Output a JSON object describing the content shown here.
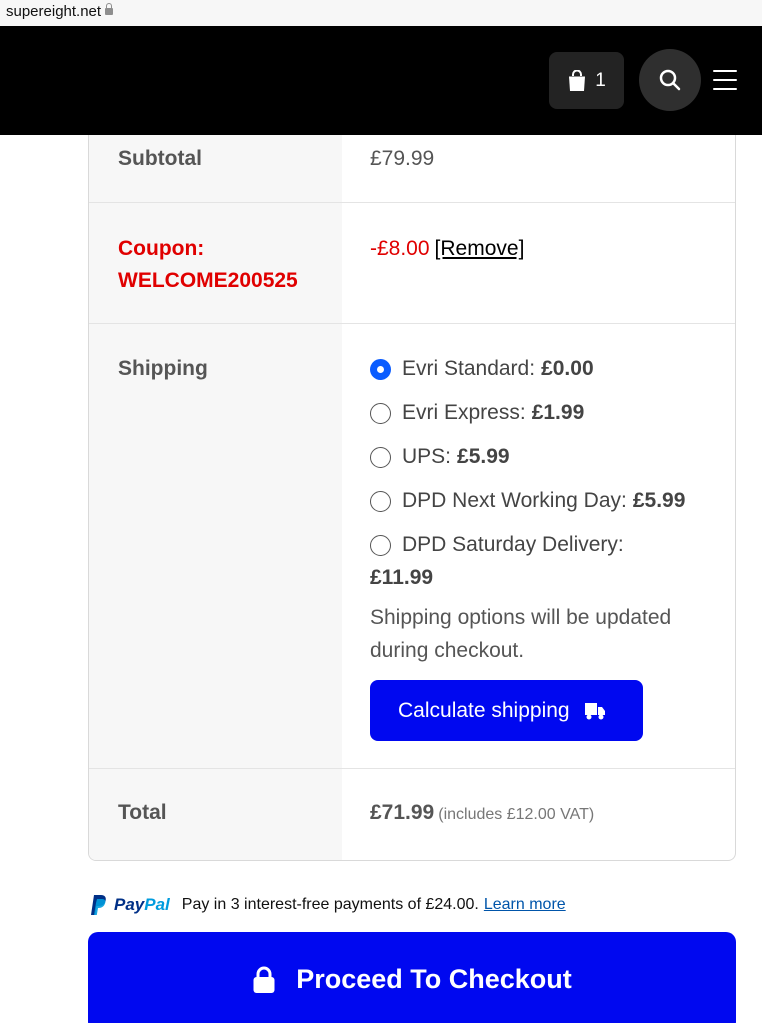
{
  "browser": {
    "url": "supereight.net"
  },
  "header": {
    "cart_count": "1",
    "icons": {
      "cart": "shopping-bag-icon",
      "search": "search-icon",
      "menu": "hamburger-menu-icon"
    }
  },
  "totals": {
    "subtotal": {
      "label": "Subtotal",
      "value": "£79.99"
    },
    "coupon": {
      "label": "Coupon:",
      "code": "WELCOME200525",
      "value": "-£8.00",
      "remove_label": "[Remove]"
    },
    "shipping": {
      "label": "Shipping",
      "options": [
        {
          "name": "Evri Standard:",
          "price": "£0.00",
          "selected": true
        },
        {
          "name": "Evri Express:",
          "price": "£1.99",
          "selected": false
        },
        {
          "name": "UPS:",
          "price": "£5.99",
          "selected": false
        },
        {
          "name": "DPD Next Working Day:",
          "price": "£5.99",
          "selected": false
        },
        {
          "name": "DPD Saturday Delivery:",
          "price": "£11.99",
          "selected": false
        }
      ],
      "note": "Shipping options will be updated during checkout.",
      "calculate_label": "Calculate shipping"
    },
    "total": {
      "label": "Total",
      "value": "£71.99",
      "vat_note": "(includes £12.00 VAT)"
    }
  },
  "paypal": {
    "brand_pay": "Pay",
    "brand_pal": "Pal",
    "message": "Pay in 3 interest-free payments of £24.00.",
    "learn_more": "Learn more"
  },
  "checkout": {
    "label": "Proceed To Checkout"
  },
  "colors": {
    "accent": "#0008f0",
    "coupon": "#e00000",
    "radio_selected": "#0a5cff",
    "header_bg": "#000000"
  }
}
